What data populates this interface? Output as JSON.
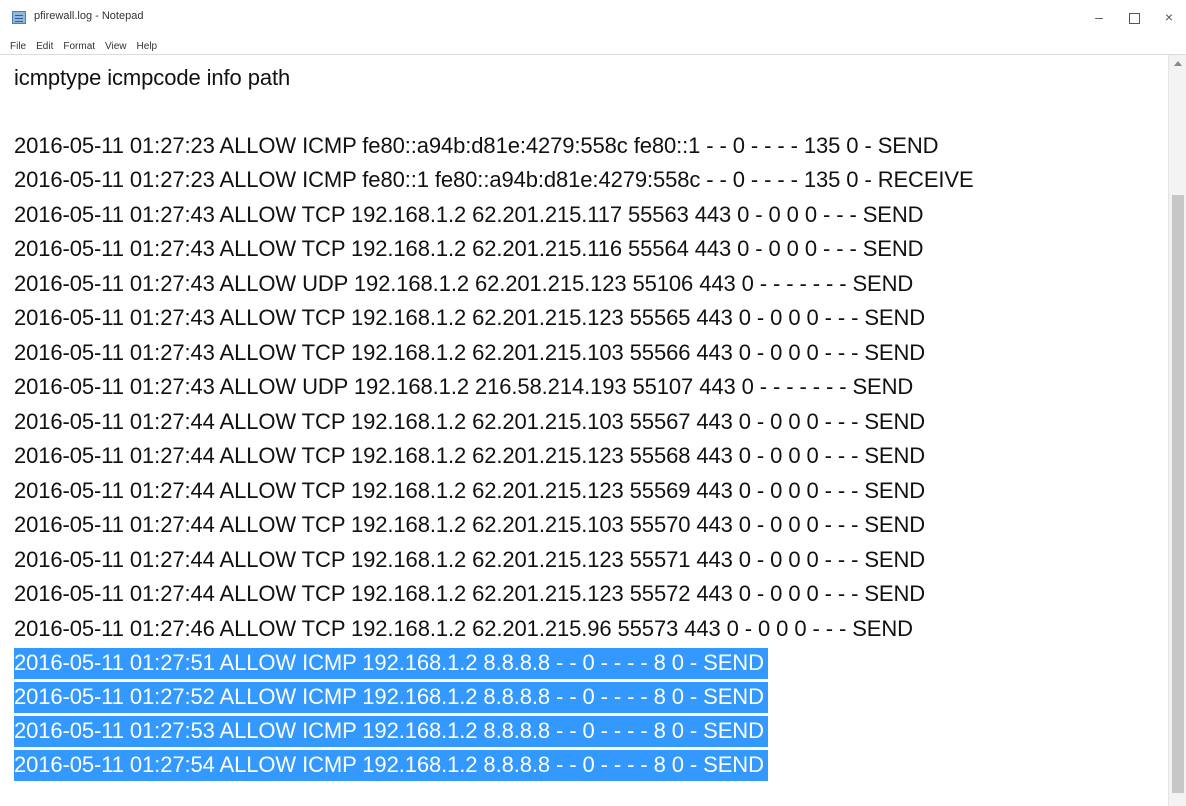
{
  "window": {
    "title": "pfirewall.log - Notepad",
    "minimize_glyph": "–",
    "close_glyph": "×"
  },
  "menu": [
    "File",
    "Edit",
    "Format",
    "View",
    "Help"
  ],
  "header_line": "icmptype icmpcode info path",
  "log_lines": [
    "2016-05-11 01:27:23 ALLOW ICMP fe80::a94b:d81e:4279:558c fe80::1 - - 0 - - - - 135 0 - SEND",
    "2016-05-11 01:27:23 ALLOW ICMP fe80::1 fe80::a94b:d81e:4279:558c - - 0 - - - - 135 0 - RECEIVE",
    "2016-05-11 01:27:43 ALLOW TCP 192.168.1.2 62.201.215.117 55563 443 0 - 0 0 0 - - - SEND",
    "2016-05-11 01:27:43 ALLOW TCP 192.168.1.2 62.201.215.116 55564 443 0 - 0 0 0 - - - SEND",
    "2016-05-11 01:27:43 ALLOW UDP 192.168.1.2 62.201.215.123 55106 443 0 - - - - - - - SEND",
    "2016-05-11 01:27:43 ALLOW TCP 192.168.1.2 62.201.215.123 55565 443 0 - 0 0 0 - - - SEND",
    "2016-05-11 01:27:43 ALLOW TCP 192.168.1.2 62.201.215.103 55566 443 0 - 0 0 0 - - - SEND",
    "2016-05-11 01:27:43 ALLOW UDP 192.168.1.2 216.58.214.193 55107 443 0 - - - - - - - SEND",
    "2016-05-11 01:27:44 ALLOW TCP 192.168.1.2 62.201.215.103 55567 443 0 - 0 0 0 - - - SEND",
    "2016-05-11 01:27:44 ALLOW TCP 192.168.1.2 62.201.215.123 55568 443 0 - 0 0 0 - - - SEND",
    "2016-05-11 01:27:44 ALLOW TCP 192.168.1.2 62.201.215.123 55569 443 0 - 0 0 0 - - - SEND",
    "2016-05-11 01:27:44 ALLOW TCP 192.168.1.2 62.201.215.103 55570 443 0 - 0 0 0 - - - SEND",
    "2016-05-11 01:27:44 ALLOW TCP 192.168.1.2 62.201.215.123 55571 443 0 - 0 0 0 - - - SEND",
    "2016-05-11 01:27:44 ALLOW TCP 192.168.1.2 62.201.215.123 55572 443 0 - 0 0 0 - - - SEND",
    "2016-05-11 01:27:46 ALLOW TCP 192.168.1.2 62.201.215.96 55573 443 0 - 0 0 0 - - - SEND",
    "2016-05-11 01:27:51 ALLOW ICMP 192.168.1.2 8.8.8.8 - - 0 - - - - 8 0 - SEND",
    "2016-05-11 01:27:52 ALLOW ICMP 192.168.1.2 8.8.8.8 - - 0 - - - - 8 0 - SEND",
    "2016-05-11 01:27:53 ALLOW ICMP 192.168.1.2 8.8.8.8 - - 0 - - - - 8 0 - SEND",
    "2016-05-11 01:27:54 ALLOW ICMP 192.168.1.2 8.8.8.8 - - 0 - - - - 8 0 - SEND"
  ],
  "selected_line_indices": [
    15,
    16,
    17,
    18
  ],
  "colors": {
    "selection": "#3399ff",
    "selection_text": "#ffffff",
    "text": "#111111"
  }
}
